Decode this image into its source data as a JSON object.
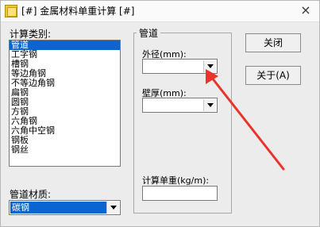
{
  "window": {
    "title": "[#] 金属材料单重计算 [#]",
    "close_glyph": "×"
  },
  "list": {
    "label": "计算类别:",
    "items": [
      "管道",
      "工字钢",
      "槽钢",
      "等边角钢",
      "不等边角钢",
      "扁钢",
      "圆钢",
      "方钢",
      "六角钢",
      "六角中空钢",
      "钢板",
      "钢丝"
    ],
    "selected_index": 0
  },
  "material": {
    "label": "管道材质:",
    "value": "碳钢"
  },
  "group": {
    "title": "管道",
    "outer_diameter_label": "外径(mm):",
    "outer_diameter_value": "",
    "wall_thickness_label": "壁厚(mm):",
    "wall_thickness_value": "",
    "unit_weight_label": "计算单重(kg/m):",
    "unit_weight_value": ""
  },
  "buttons": {
    "close_label": "关闭",
    "about_label": "关于(A)"
  },
  "colors": {
    "selection": "#0a64d2",
    "annotation_arrow": "#e8342c"
  }
}
